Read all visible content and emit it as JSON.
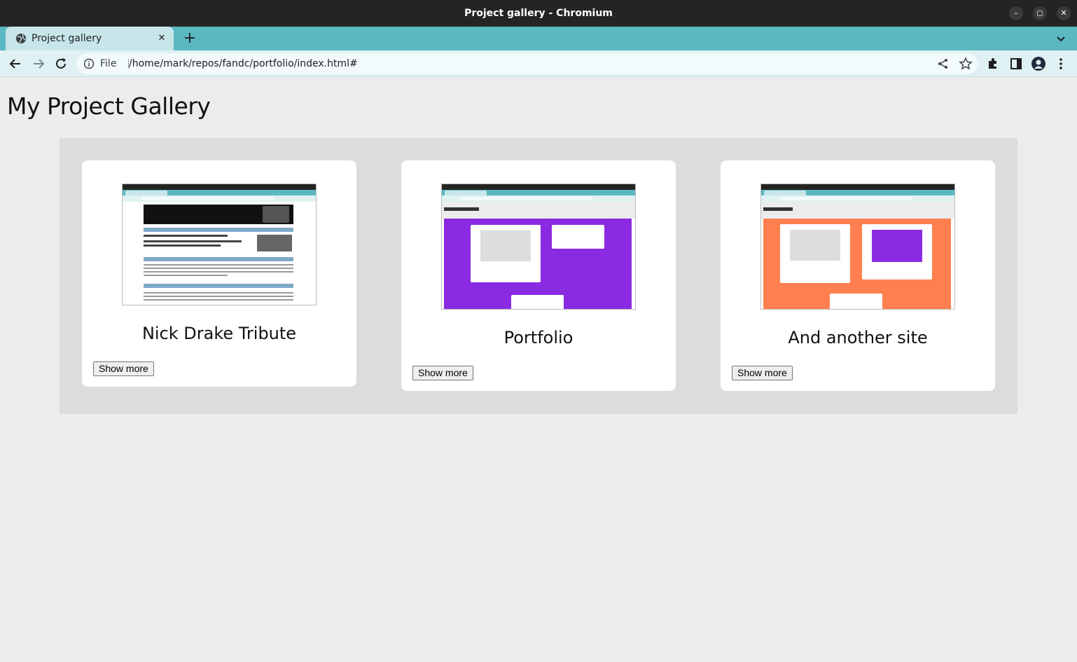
{
  "window": {
    "title": "Project gallery - Chromium"
  },
  "tab": {
    "title": "Project gallery",
    "close": "✕",
    "new_tab": "+"
  },
  "address_bar": {
    "scheme": "File",
    "url": "/home/mark/repos/fandc/portfolio/index.html#"
  },
  "page": {
    "heading": "My Project Gallery",
    "cards": [
      {
        "title": "Nick Drake Tribute",
        "button": "Show more",
        "thumb_theme": "white"
      },
      {
        "title": "Portfolio",
        "button": "Show more",
        "thumb_theme": "#8a2be2"
      },
      {
        "title": "And another site",
        "button": "Show more",
        "thumb_theme": "#ff7f50"
      }
    ]
  },
  "colors": {
    "titlebar": "#242424",
    "tabstrip": "#5ab8c1",
    "toolbar": "#e0f1f3",
    "page_bg": "#ececec",
    "gallery_bg": "#dcdcdc",
    "card_bg": "#ffffff"
  }
}
